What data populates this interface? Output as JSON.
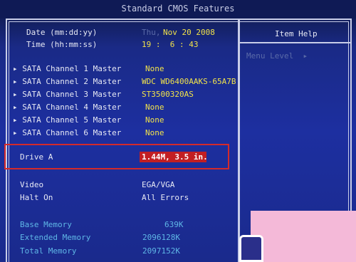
{
  "title": "Standard CMOS Features",
  "help": {
    "heading": "Item Help",
    "menu_level": "Menu Level  ▸"
  },
  "datetime": {
    "date_label": "Date (mm:dd:yy)",
    "date_dim": "Thu,",
    "date_value": "Nov 20 2008",
    "time_label": "Time (hh:mm:ss)",
    "time_value": "19 :  6 : 43"
  },
  "sata": [
    {
      "label": "SATA Channel 1 Master",
      "value": "None"
    },
    {
      "label": "SATA Channel 2 Master",
      "value": "WDC WD6400AAKS-65A7B"
    },
    {
      "label": "SATA Channel 3 Master",
      "value": "ST3500320AS"
    },
    {
      "label": "SATA Channel 4 Master",
      "value": "None"
    },
    {
      "label": "SATA Channel 5 Master",
      "value": "None"
    },
    {
      "label": "SATA Channel 6 Master",
      "value": "None"
    }
  ],
  "drive": {
    "label": "Drive A",
    "value": "1.44M, 3.5 in."
  },
  "video": {
    "label": "Video",
    "value": "EGA/VGA"
  },
  "halt": {
    "label": "Halt On",
    "value": "All Errors"
  },
  "memory": [
    {
      "label": "Base Memory",
      "value": "639K"
    },
    {
      "label": "Extended Memory",
      "value": "2096128K"
    },
    {
      "label": "Total Memory",
      "value": "2097152K"
    }
  ],
  "colors": {
    "background": "#1d2fa0",
    "value_yellow": "#f1e24a",
    "memory_cyan": "#5fb7e6",
    "highlight_red": "#c21f23"
  }
}
